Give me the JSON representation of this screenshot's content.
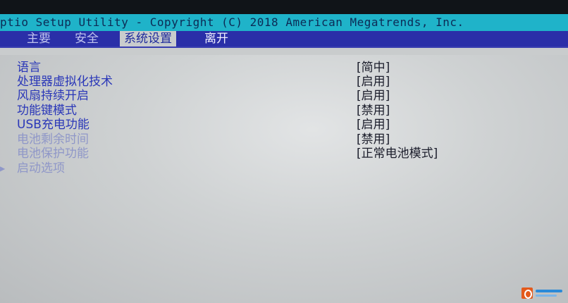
{
  "header": {
    "title": "ptio Setup Utility - Copyright (C) 2018 American Megatrends, Inc."
  },
  "tabs": [
    {
      "label": "主要"
    },
    {
      "label": "安全"
    },
    {
      "label": "系统设置"
    },
    {
      "label": "离开"
    }
  ],
  "settings": [
    {
      "label": "语言",
      "value": "[简中]"
    },
    {
      "label": "处理器虚拟化技术",
      "value": "[启用]"
    },
    {
      "label": "风扇持续开启",
      "value": "[启用]"
    },
    {
      "label": "功能键模式",
      "value": "[禁用]"
    },
    {
      "label": "USB充电功能",
      "value": "[启用]"
    },
    {
      "label": "电池剩余时间",
      "value": "[禁用]"
    },
    {
      "label": "电池保护功能",
      "value": "[正常电池模式]"
    },
    {
      "label": "启动选项",
      "value": ""
    }
  ],
  "colors": {
    "title_bar": "#1fb3c9",
    "tab_bar": "#2a2fa8",
    "active_label": "#2a37b8",
    "dim_label": "#8f97c8"
  },
  "icons": {
    "submenu": "triangle-right-icon",
    "watermark": "office-logo-icon"
  }
}
